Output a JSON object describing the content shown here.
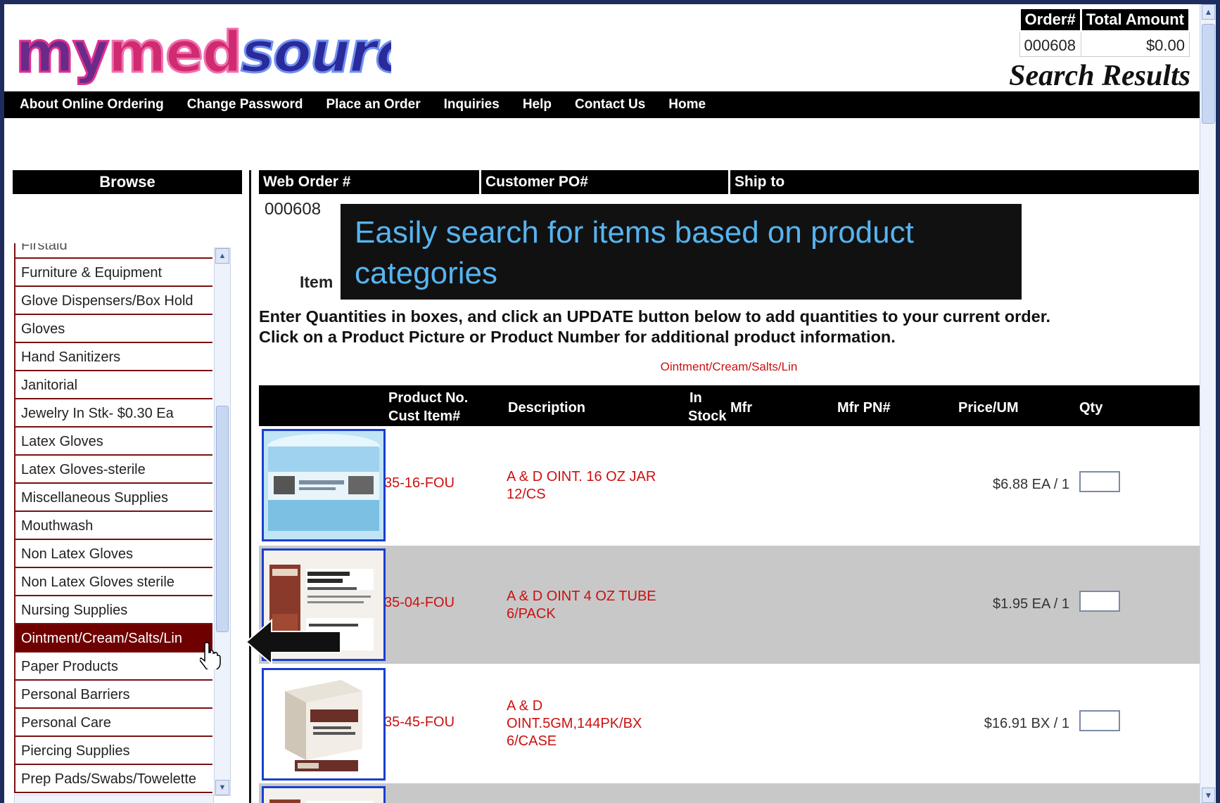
{
  "header": {
    "logo_text": "mymedsource",
    "page_heading": "Search Results",
    "order_summary": {
      "order_label": "Order#",
      "total_label": "Total Amount",
      "order_value": "000608",
      "total_value": "$0.00"
    }
  },
  "nav": {
    "items": [
      "About Online Ordering",
      "Change Password",
      "Place an Order",
      "Inquiries",
      "Help",
      "Contact Us",
      "Home"
    ]
  },
  "browse": {
    "title": "Browse",
    "partial_top": "Firstaid",
    "categories": [
      "Furniture & Equipment",
      "Glove Dispensers/Box Hold",
      "Gloves",
      "Hand Sanitizers",
      "Janitorial",
      "Jewelry In Stk- $0.30 Ea",
      "Latex Gloves",
      "Latex Gloves-sterile",
      "Miscellaneous Supplies",
      "Mouthwash",
      "Non Latex Gloves",
      "Non Latex Gloves sterile",
      "Nursing Supplies",
      "Ointment/Cream/Salts/Lin",
      "Paper Products",
      "Personal Barriers",
      "Personal Care",
      "Piercing Supplies",
      "Prep Pads/Swabs/Towelette"
    ],
    "selected_index": 13
  },
  "order_info": {
    "columns": [
      "Web Order #",
      "Customer PO#",
      "Ship to"
    ],
    "web_order": "000608"
  },
  "main": {
    "item_label": "Item",
    "instructions_line1": "Enter Quantities in boxes, and click an UPDATE button below to add quantities to your current order.",
    "instructions_line2": "Click on a Product Picture or Product Number for additional product information.",
    "category_crumb": "Ointment/Cream/Salts/Lin"
  },
  "results": {
    "columns": {
      "product_no": "Product No.",
      "cust_item": "Cust Item#",
      "description": "Description",
      "in": "In",
      "stock": "Stock",
      "mfr": "Mfr",
      "mfr_pn": "Mfr PN#",
      "price": "Price/UM",
      "qty": "Qty"
    },
    "rows": [
      {
        "product_no": "35-16-FOU",
        "desc1": "A & D OINT. 16 OZ JAR",
        "desc2": "12/CS",
        "desc3": "",
        "price": "$6.88 EA / 1"
      },
      {
        "product_no": "35-04-FOU",
        "desc1": "A & D OINT 4 OZ TUBE",
        "desc2": "6/PACK",
        "desc3": "",
        "price": "$1.95 EA / 1"
      },
      {
        "product_no": "35-45-FOU",
        "desc1": "A & D",
        "desc2": "OINT.5GM,144PK/BX",
        "desc3": "6/CASE",
        "price": "$16.91 BX / 1"
      }
    ]
  },
  "callout": {
    "text": "Easily search for items based on product categories"
  },
  "colors": {
    "accent_red": "#cc1010",
    "selected_category": "#6e0000",
    "callout_text": "#56b4f0",
    "border_blue": "#1e2d5e"
  }
}
